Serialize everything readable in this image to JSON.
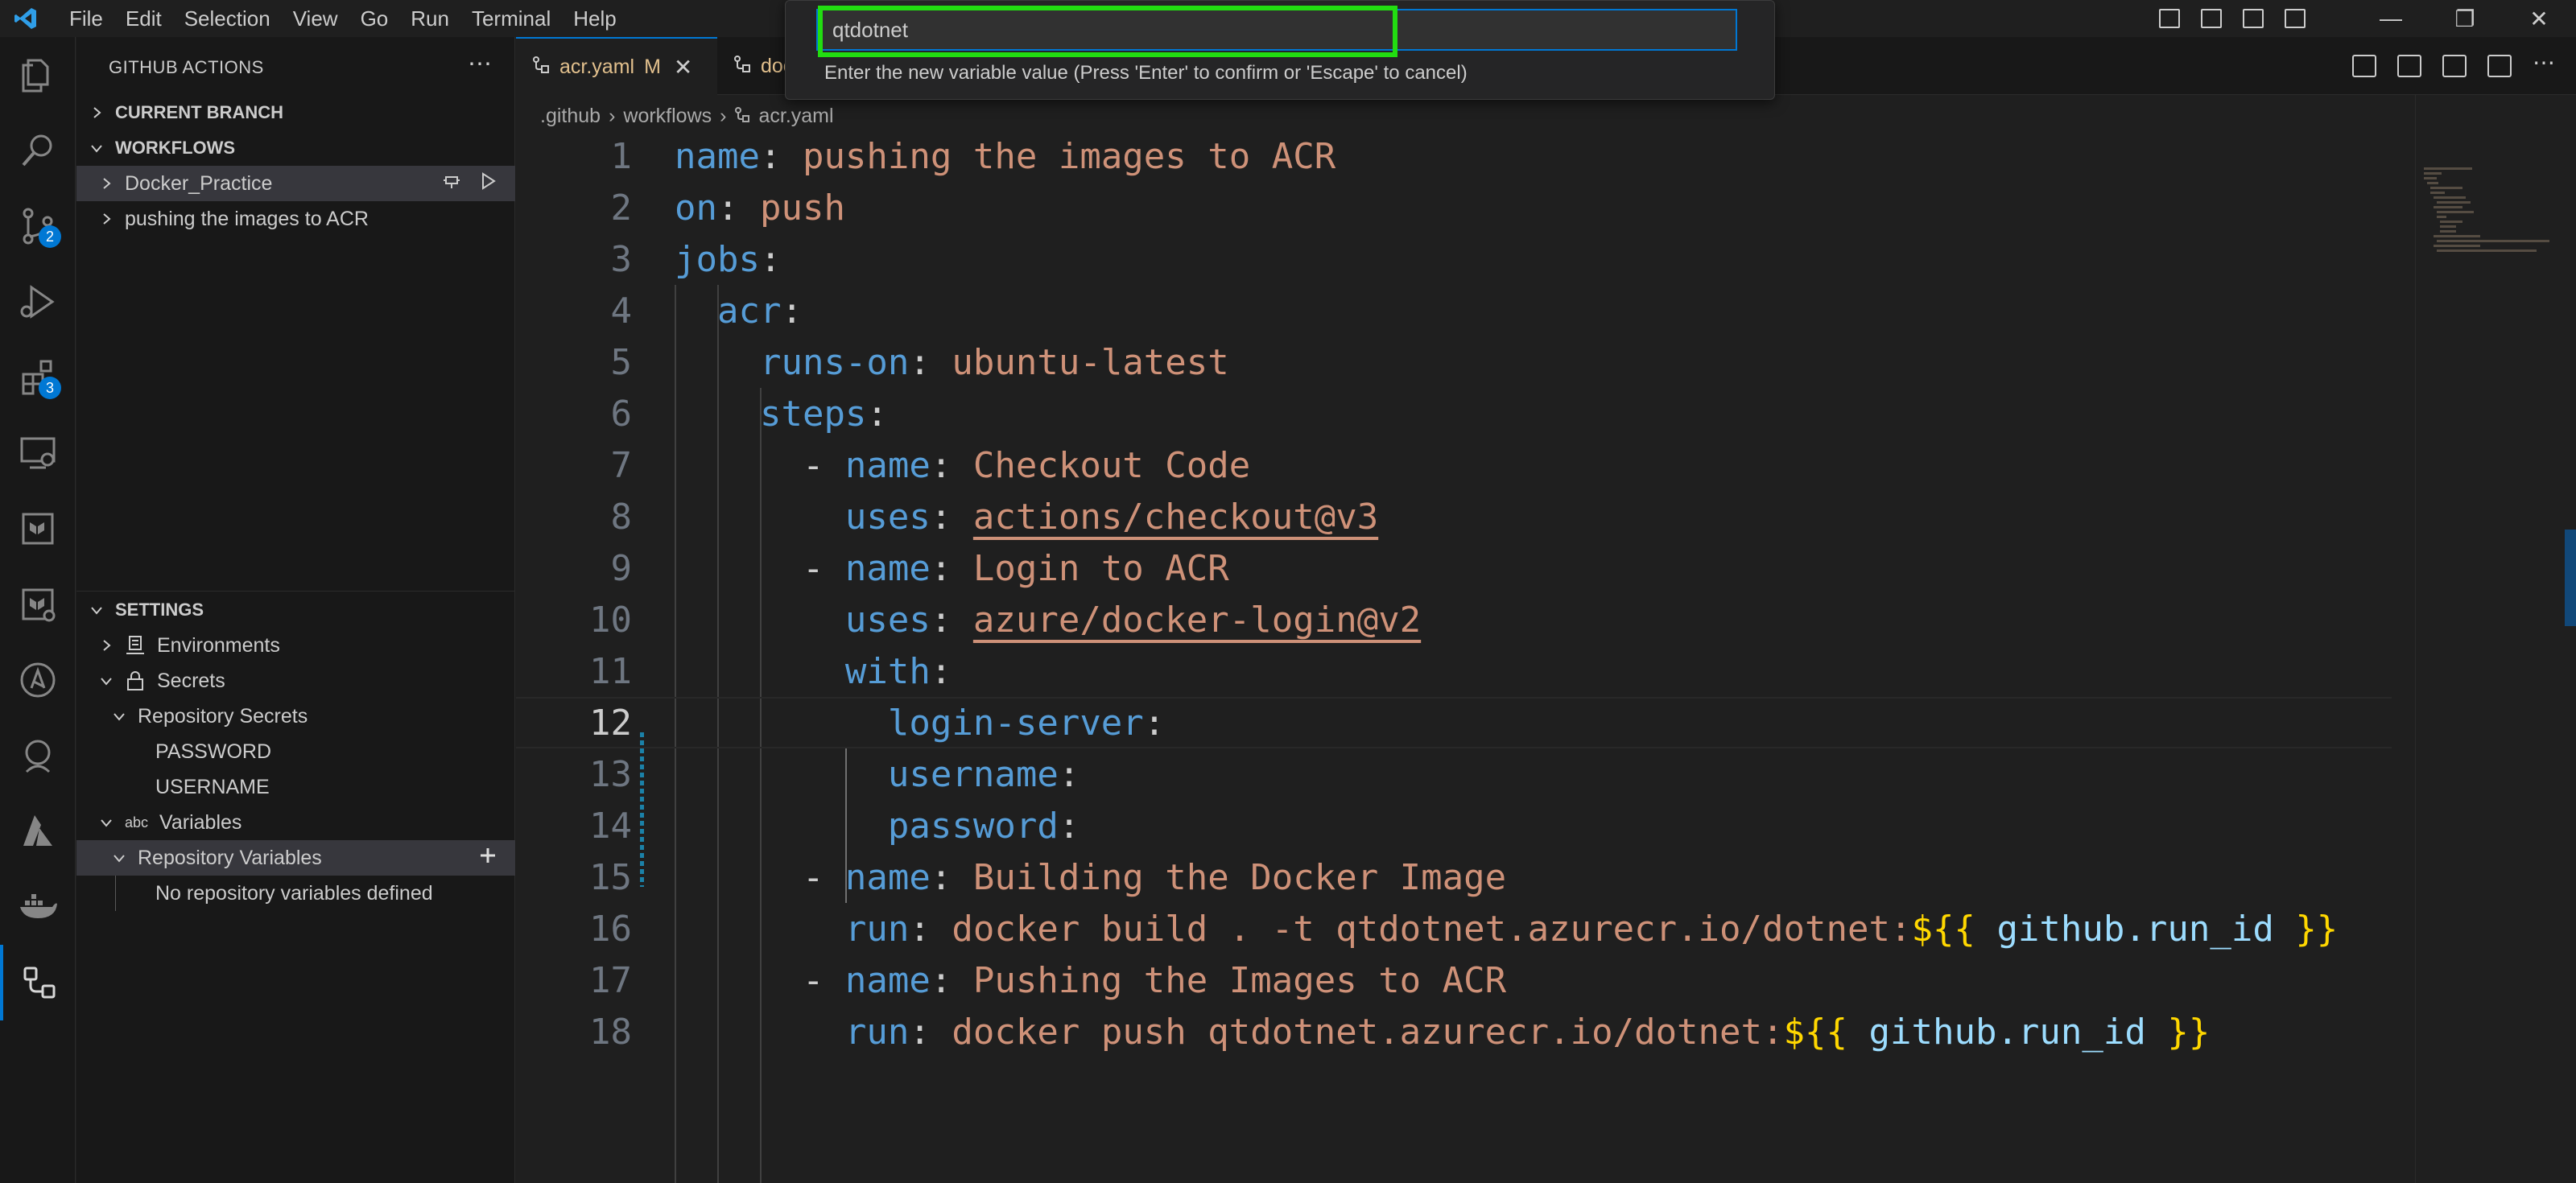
{
  "menu": [
    "File",
    "Edit",
    "Selection",
    "View",
    "Go",
    "Run",
    "Terminal",
    "Help"
  ],
  "activity_badges": {
    "source_control": "2",
    "extensions": "3"
  },
  "sidebar": {
    "title": "GITHUB ACTIONS",
    "current_branch": "CURRENT BRANCH",
    "workflows": "WORKFLOWS",
    "workflow_items": [
      "Docker_Practice",
      "pushing the images to ACR"
    ],
    "settings": "SETTINGS",
    "environments": "Environments",
    "secrets": "Secrets",
    "repository_secrets": "Repository Secrets",
    "secret_items": [
      "PASSWORD",
      "USERNAME"
    ],
    "variables": "Variables",
    "variables_prefix": "abc",
    "repository_variables": "Repository Variables",
    "no_variables": "No repository variables defined"
  },
  "tabs": [
    {
      "label": "acr.yaml",
      "modified": "M",
      "active": true
    },
    {
      "label": "doc",
      "modified": "",
      "active": false
    }
  ],
  "breadcrumb": [
    ".github",
    "workflows",
    "acr.yaml"
  ],
  "quick_input": {
    "value": "qtdotnet",
    "message": "Enter the new variable value (Press 'Enter' to confirm or 'Escape' to cancel)"
  },
  "code": {
    "line_numbers": [
      "1",
      "2",
      "3",
      "4",
      "5",
      "6",
      "7",
      "8",
      "9",
      "10",
      "11",
      "12",
      "13",
      "14",
      "15",
      "16",
      "17",
      "18"
    ],
    "current_line": "12",
    "l1": {
      "key": "name",
      "val": "pushing the images to ACR"
    },
    "l2": {
      "key": "on",
      "val": "push"
    },
    "l3": {
      "key": "jobs"
    },
    "l4": {
      "key": "acr"
    },
    "l5": {
      "key": "runs-on",
      "val": "ubuntu-latest"
    },
    "l6": {
      "key": "steps"
    },
    "l7": {
      "key": "name",
      "val": "Checkout Code"
    },
    "l8": {
      "key": "uses",
      "val": "actions/checkout@v3"
    },
    "l9": {
      "key": "name",
      "val": "Login to ACR"
    },
    "l10": {
      "key": "uses",
      "val": "azure/docker-login@v2"
    },
    "l11": {
      "key": "with"
    },
    "l12": {
      "key": "login-server"
    },
    "l13": {
      "key": "username"
    },
    "l14": {
      "key": "password"
    },
    "l15": {
      "key": "name",
      "val": "Building the Docker Image"
    },
    "l16": {
      "key": "run",
      "val": "docker build . -t qtdotnet.azurecr.io/dotnet:",
      "expr_open": "${{",
      "expr_var": "github.run_id",
      "expr_close": "}}"
    },
    "l17": {
      "key": "name",
      "val": "Pushing the Images to ACR"
    },
    "l18": {
      "key": "run",
      "val": "docker push qtdotnet.azurecr.io/dotnet:",
      "expr_open": "${{",
      "expr_var": "github.run_id",
      "expr_close": "}}"
    }
  },
  "colors": {
    "accent": "#0078d4",
    "highlight_box": "#22dd11",
    "keyword": "#569cd6",
    "string": "#ce9178"
  }
}
